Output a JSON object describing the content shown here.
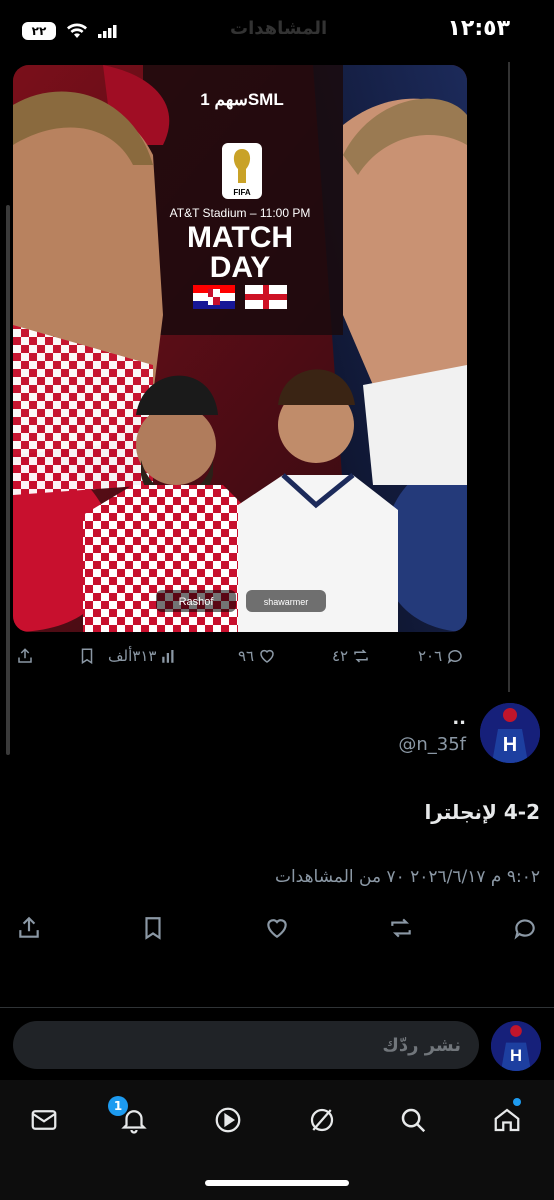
{
  "status_bar": {
    "time": "١٢:٥٣",
    "battery": "٢٢"
  },
  "header": {
    "ghost_title": "المشاهدات"
  },
  "media": {
    "brand_logo": "سهم 1SML",
    "fifa_label": "FIFA",
    "venue": "AT&T Stadium – 11:00 PM",
    "match_day_line1": "MATCH",
    "match_day_line2": "DAY",
    "sponsor_left": "Rashof",
    "sponsor_right": "shawarmer"
  },
  "tweet_metrics": {
    "replies": "٢٠٦",
    "retweets": "٤٢",
    "likes": "٩٦",
    "views": "٣١٣ألف"
  },
  "reply": {
    "display_name": "..",
    "handle": "@n_35f",
    "text": "4-2 لإنجلترا",
    "meta": "٩:٠٢ م ٢٠٢٦/٦/١٧ ٧٠ من المشاهدات"
  },
  "composer": {
    "placeholder": "نشر ردّك"
  },
  "tabbar": {
    "notifications_badge": "1"
  },
  "colors": {
    "croatia_red": "#c8102e",
    "england_navy": "#1c2a5a",
    "accent": "#1d9bf0"
  }
}
